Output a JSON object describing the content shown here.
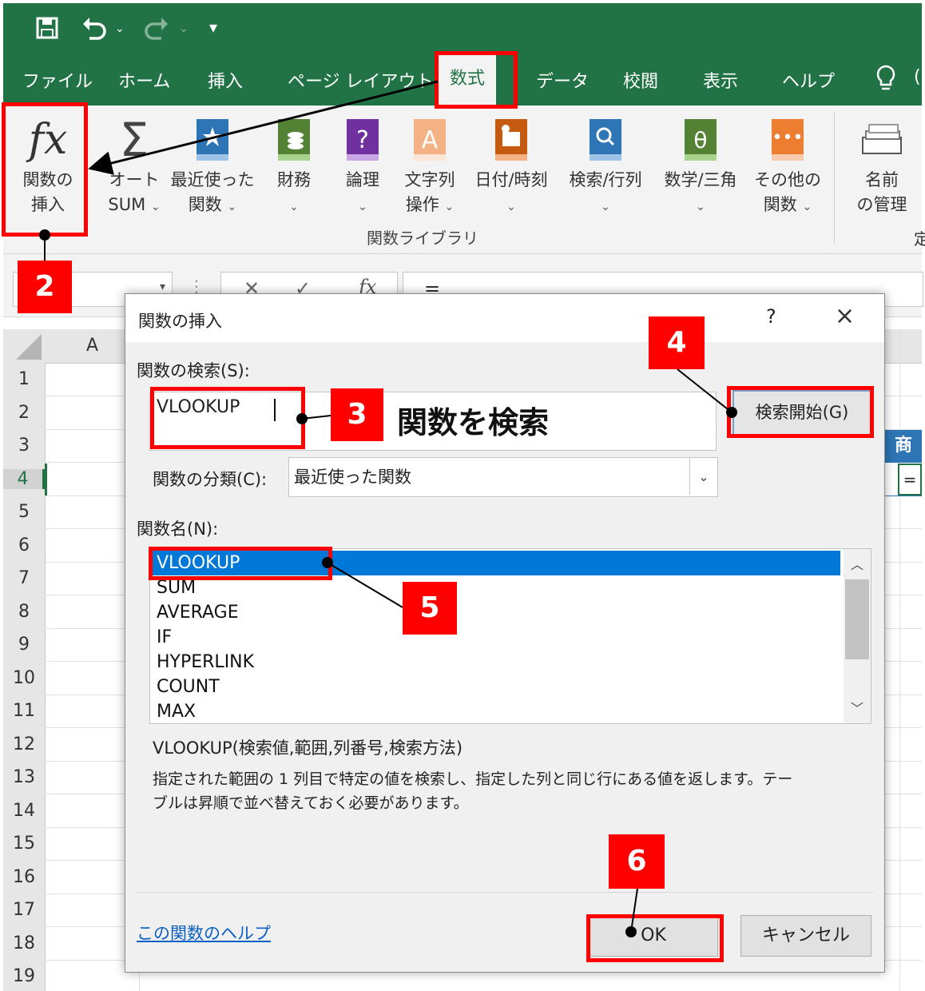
{
  "quick_access": {
    "save_icon": "save-icon",
    "undo_icon": "undo-icon",
    "redo_icon": "redo-icon",
    "customize_icon": "customize-icon"
  },
  "tabs": [
    "ファイル",
    "ホーム",
    "挿入",
    "ページ レイアウト",
    "数式",
    "データ",
    "校閲",
    "表示",
    "ヘルプ"
  ],
  "active_tab": "数式",
  "ribbon": {
    "insert_function": [
      "関数の",
      "挿入"
    ],
    "autosum": [
      "オート",
      "SUM"
    ],
    "recent": [
      "最近使った",
      "関数"
    ],
    "financial": "財務",
    "logical": "論理",
    "text": [
      "文字列",
      "操作"
    ],
    "datetime": "日付/時刻",
    "lookup": "検索/行列",
    "math": "数学/三角",
    "other": [
      "その他の",
      "関数"
    ],
    "name_mgr": [
      "名前",
      "の管理"
    ],
    "group_label": "関数ライブラリ",
    "partial_right": "定"
  },
  "formula_bar": {
    "fx": "fx",
    "value": "="
  },
  "grid": {
    "column_a": "A",
    "rows": [
      "1",
      "2",
      "3",
      "4",
      "5",
      "6",
      "7",
      "8",
      "9",
      "10",
      "11",
      "12",
      "13",
      "14",
      "15",
      "16",
      "17",
      "18",
      "19"
    ],
    "partial_cell_header": "商",
    "partial_cell_value": "="
  },
  "dialog": {
    "title": "関数の挿入",
    "help_q": "?",
    "close": "×",
    "search_label": "関数の検索(S):",
    "search_value": "VLOOKUP",
    "search_button": "検索開始(G)",
    "category_label": "関数の分類(C):",
    "category_value": "最近使った関数",
    "list_label": "関数名(N):",
    "functions": [
      "VLOOKUP",
      "SUM",
      "AVERAGE",
      "IF",
      "HYPERLINK",
      "COUNT",
      "MAX"
    ],
    "syntax": "VLOOKUP(検索値,範囲,列番号,検索方法)",
    "description_line1": "指定された範囲の 1 列目で特定の値を検索し、指定した列と同じ行にある値を返します。テー",
    "description_line2": "ブルは昇順で並べ替えておく必要があります。",
    "help_link": "この関数のヘルプ",
    "ok": "OK",
    "cancel": "キャンセル"
  },
  "annotations": {
    "steps": [
      "2",
      "3",
      "4",
      "5",
      "6"
    ],
    "caption": "関数を検索"
  }
}
